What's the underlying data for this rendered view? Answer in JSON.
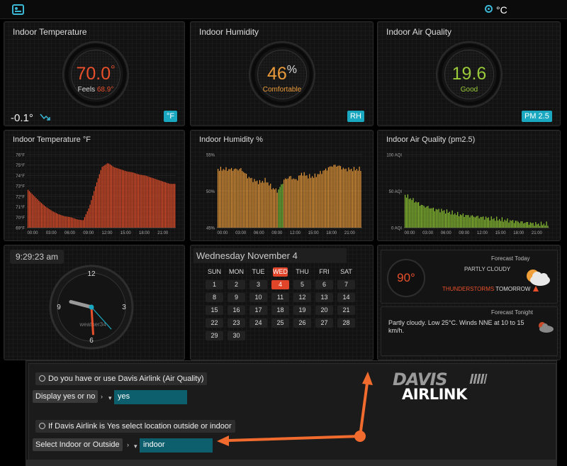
{
  "topbar": {
    "unit": "°C"
  },
  "temperature": {
    "title": "Indoor Temperature",
    "value": "70.0",
    "degree": "°",
    "feels_label": "Feels",
    "feels_value": "68.9°",
    "trend": "-0.1°",
    "unit_badge": "°F",
    "value_color": "#e8502c"
  },
  "humidity": {
    "title": "Indoor Humidity",
    "value": "46",
    "percent": "%",
    "status": "Comfortable",
    "unit_badge": "RH",
    "value_color": "#e99a3a"
  },
  "air_quality": {
    "title": "Indoor Air Quality",
    "value": "19.6",
    "status": "Good",
    "unit_badge": "PM 2.5",
    "value_color": "#9ac93a"
  },
  "temp_chart": {
    "title": "Indoor Temperature °F",
    "color": "#e8502c"
  },
  "humidity_chart": {
    "title": "Indoor Humidity %",
    "color": "#e99a3a"
  },
  "aq_chart": {
    "title": "Indoor Air Quality (pm2.5)",
    "color": "#8ec634"
  },
  "chart_data": [
    {
      "type": "area",
      "title": "Indoor Temperature °F",
      "y_ticks": [
        "76°F",
        "75°F",
        "74°F",
        "73°F",
        "72°F",
        "71°F",
        "70°F",
        "69°F"
      ],
      "x_ticks": [
        "00:00",
        "03:00",
        "06:00",
        "09:00",
        "12:00",
        "15:00",
        "18:00",
        "21:00"
      ],
      "ylim": [
        69,
        76
      ],
      "x": [
        0,
        1,
        2,
        3,
        4,
        5,
        6,
        7,
        8,
        9,
        10,
        11,
        12,
        13,
        14,
        15,
        16,
        17,
        18,
        19,
        20,
        21,
        22,
        23
      ],
      "values": [
        72.7,
        72.1,
        71.5,
        71.0,
        70.6,
        70.3,
        70.1,
        70.0,
        69.8,
        69.7,
        71.0,
        73.0,
        74.8,
        75.2,
        74.8,
        74.6,
        74.4,
        74.3,
        74.1,
        74.0,
        73.8,
        73.6,
        73.4,
        73.2
      ]
    },
    {
      "type": "bar",
      "title": "Indoor Humidity %",
      "y_ticks": [
        "55%",
        "50%",
        "45%"
      ],
      "x_ticks": [
        "00:00",
        "03:00",
        "06:00",
        "09:00",
        "12:00",
        "15:00",
        "18:00",
        "21:00"
      ],
      "ylim": [
        45,
        55
      ],
      "x": [
        0,
        1,
        2,
        3,
        4,
        5,
        6,
        7,
        8,
        9,
        10,
        11,
        12,
        13,
        14,
        15,
        16,
        17,
        18,
        19,
        20,
        21,
        22,
        23
      ],
      "values": [
        53.0,
        53.0,
        53.0,
        53.0,
        53.0,
        52.0,
        51.5,
        51.2,
        51.5,
        50.5,
        50.0,
        51.5,
        52.0,
        51.5,
        52.5,
        52.0,
        52.0,
        52.5,
        53.0,
        53.5,
        53.5,
        53.0,
        53.0,
        53.0
      ],
      "highlight_color": "#7cc33a",
      "highlight_x": [
        10
      ]
    },
    {
      "type": "bar",
      "title": "Indoor Air Quality (pm2.5)",
      "y_ticks": [
        "100 AQI",
        "50 AQI",
        "0 AQI"
      ],
      "x_ticks": [
        "00:00",
        "03:00",
        "06:00",
        "09:00",
        "12:00",
        "15:00",
        "18:00",
        "21:00"
      ],
      "ylim": [
        0,
        100
      ],
      "x": [
        0,
        1,
        2,
        3,
        4,
        5,
        6,
        7,
        8,
        9,
        10,
        11,
        12,
        13,
        14,
        15,
        16,
        17,
        18,
        19,
        20,
        21,
        22,
        23
      ],
      "values": [
        45,
        40,
        35,
        30,
        28,
        25,
        24,
        22,
        20,
        18,
        17,
        16,
        15,
        14,
        13,
        12,
        11,
        10,
        9,
        8,
        7,
        6,
        5,
        5
      ]
    }
  ],
  "clock": {
    "time": "9:29:23 am",
    "brand": "weather34",
    "numerals": [
      "12",
      "3",
      "6",
      "9"
    ],
    "hour": 9,
    "minute": 29,
    "second": 23
  },
  "calendar": {
    "title": "Wednesday November 4",
    "weekdays": [
      "SUN",
      "MON",
      "TUE",
      "WED",
      "THU",
      "FRI",
      "SAT"
    ],
    "today_index": 3,
    "weeks": [
      [
        "1",
        "2",
        "3",
        "4",
        "5",
        "6",
        "7"
      ],
      [
        "8",
        "9",
        "10",
        "11",
        "12",
        "13",
        "14"
      ],
      [
        "15",
        "16",
        "17",
        "18",
        "19",
        "20",
        "21"
      ],
      [
        "22",
        "23",
        "24",
        "25",
        "26",
        "27",
        "28"
      ],
      [
        "29",
        "30",
        "",
        "",
        "",
        "",
        ""
      ]
    ],
    "today": "4"
  },
  "forecast": {
    "today_label": "Forecast Today",
    "temp": "90°",
    "condition": "PARTLY CLOUDY",
    "alert": "THUNDERSTORMS",
    "alert_when": "TOMORROW",
    "tonight_label": "Forecast Tonight",
    "tonight_text": "Partly cloudy. Low 25°C. Winds NNE at 10 to 15 km/h."
  },
  "settings": {
    "q1": "Do you have or use Davis Airlink (Air Quality)",
    "q1_label": "Display yes or no",
    "q1_value": "yes",
    "q2": "If Davis Airlink is Yes select location outside or indoor",
    "q2_label": "Select Indoor or Outside",
    "q2_value": "indoor"
  },
  "logo": {
    "line1": "DAVIS",
    "line2": "AIRLINK"
  },
  "annotation": {
    "color": "#f26b2e"
  }
}
